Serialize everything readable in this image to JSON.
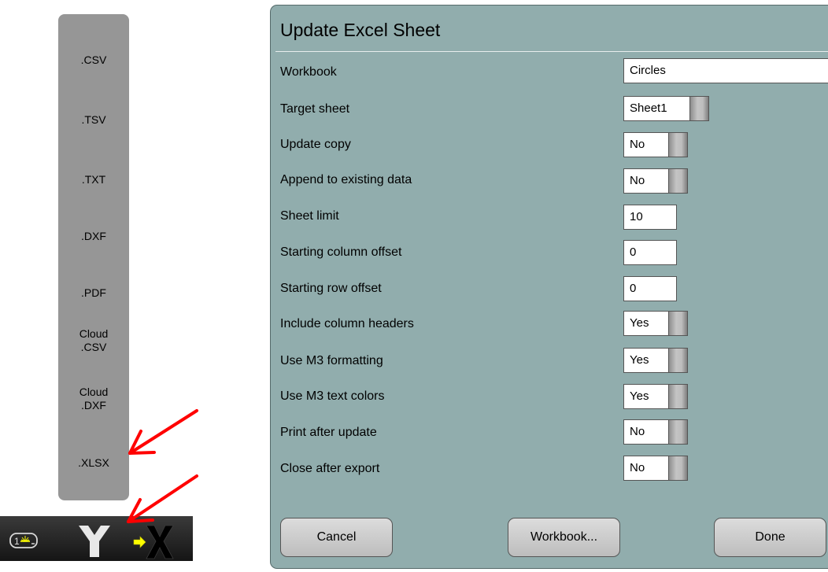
{
  "export_menu": {
    "items": [
      ".CSV",
      ".TSV",
      ".TXT",
      ".DXF",
      ".PDF",
      "Cloud\n.CSV",
      "Cloud\n.DXF",
      ".XLSX"
    ]
  },
  "toolbar": {
    "layer_badge": "1",
    "icons": [
      "layer-icon",
      "merge-icon",
      "close-icon"
    ]
  },
  "dialog": {
    "title": "Update Excel Sheet",
    "rows": [
      {
        "label": "Workbook",
        "value": "Circles",
        "kind": "field"
      },
      {
        "label": "Target sheet",
        "value": "Sheet1",
        "kind": "dropdown"
      },
      {
        "label": "Update copy",
        "value": "No",
        "kind": "toggle"
      },
      {
        "label": "Append to existing data",
        "value": "No",
        "kind": "toggle"
      },
      {
        "label": "Sheet limit",
        "value": "10",
        "kind": "input"
      },
      {
        "label": "Starting column offset",
        "value": "0",
        "kind": "input"
      },
      {
        "label": "Starting row offset",
        "value": "0",
        "kind": "input"
      },
      {
        "label": "Include column headers",
        "value": "Yes",
        "kind": "toggle"
      },
      {
        "label": "Use M3 formatting",
        "value": "Yes",
        "kind": "toggle"
      },
      {
        "label": "Use M3 text colors",
        "value": "Yes",
        "kind": "toggle"
      },
      {
        "label": "Print after update",
        "value": "No",
        "kind": "toggle"
      },
      {
        "label": "Close after export",
        "value": "No",
        "kind": "toggle"
      }
    ],
    "buttons": {
      "cancel": "Cancel",
      "workbook": "Workbook...",
      "done": "Done"
    }
  },
  "colors": {
    "dialog_bg": "#91adad",
    "menu_bg": "#969696",
    "arrow": "#ff0000",
    "toolbar_bg": "#181818"
  }
}
